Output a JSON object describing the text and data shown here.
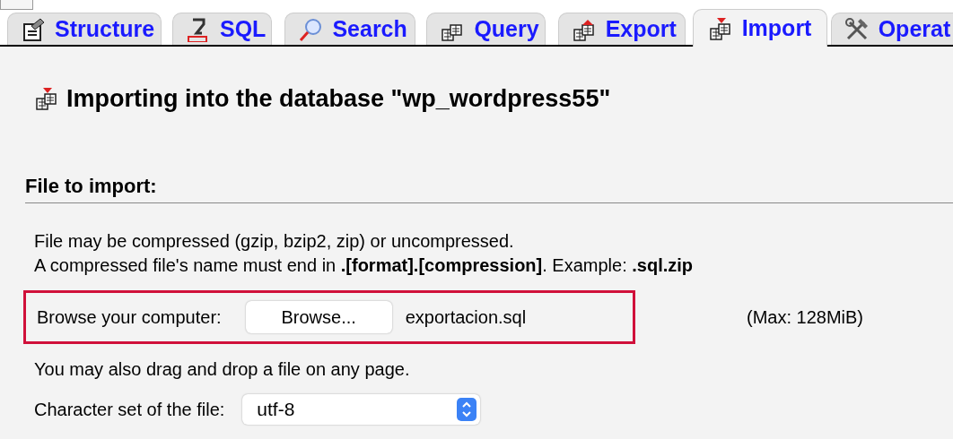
{
  "tabs": [
    {
      "label": "Structure",
      "kind": "structure",
      "selected": false
    },
    {
      "label": "SQL",
      "kind": "sql",
      "selected": false
    },
    {
      "label": "Search",
      "kind": "search",
      "selected": false
    },
    {
      "label": "Query",
      "kind": "query",
      "selected": false
    },
    {
      "label": "Export",
      "kind": "export",
      "selected": false
    },
    {
      "label": "Import",
      "kind": "import",
      "selected": true
    },
    {
      "label": "Operat",
      "kind": "operations",
      "selected": false
    }
  ],
  "page_title": "Importing into the database \"wp_wordpress55\"",
  "section": {
    "title": "File to import:",
    "notes": [
      "File may be compressed (gzip, bzip2, zip) or uncompressed.",
      "A compressed file's name must end in **.[format].[compression]**. Example: **.sql.zip**"
    ],
    "browse": {
      "label": "Browse your computer:",
      "button": "Browse...",
      "file_name": "exportacion.sql",
      "max_size": "(Max: 128MiB)",
      "highlighted": true
    },
    "drag_hint": "You may also drag and drop a file on any page.",
    "charset": {
      "label": "Character set of the file:",
      "value": "utf-8"
    }
  }
}
